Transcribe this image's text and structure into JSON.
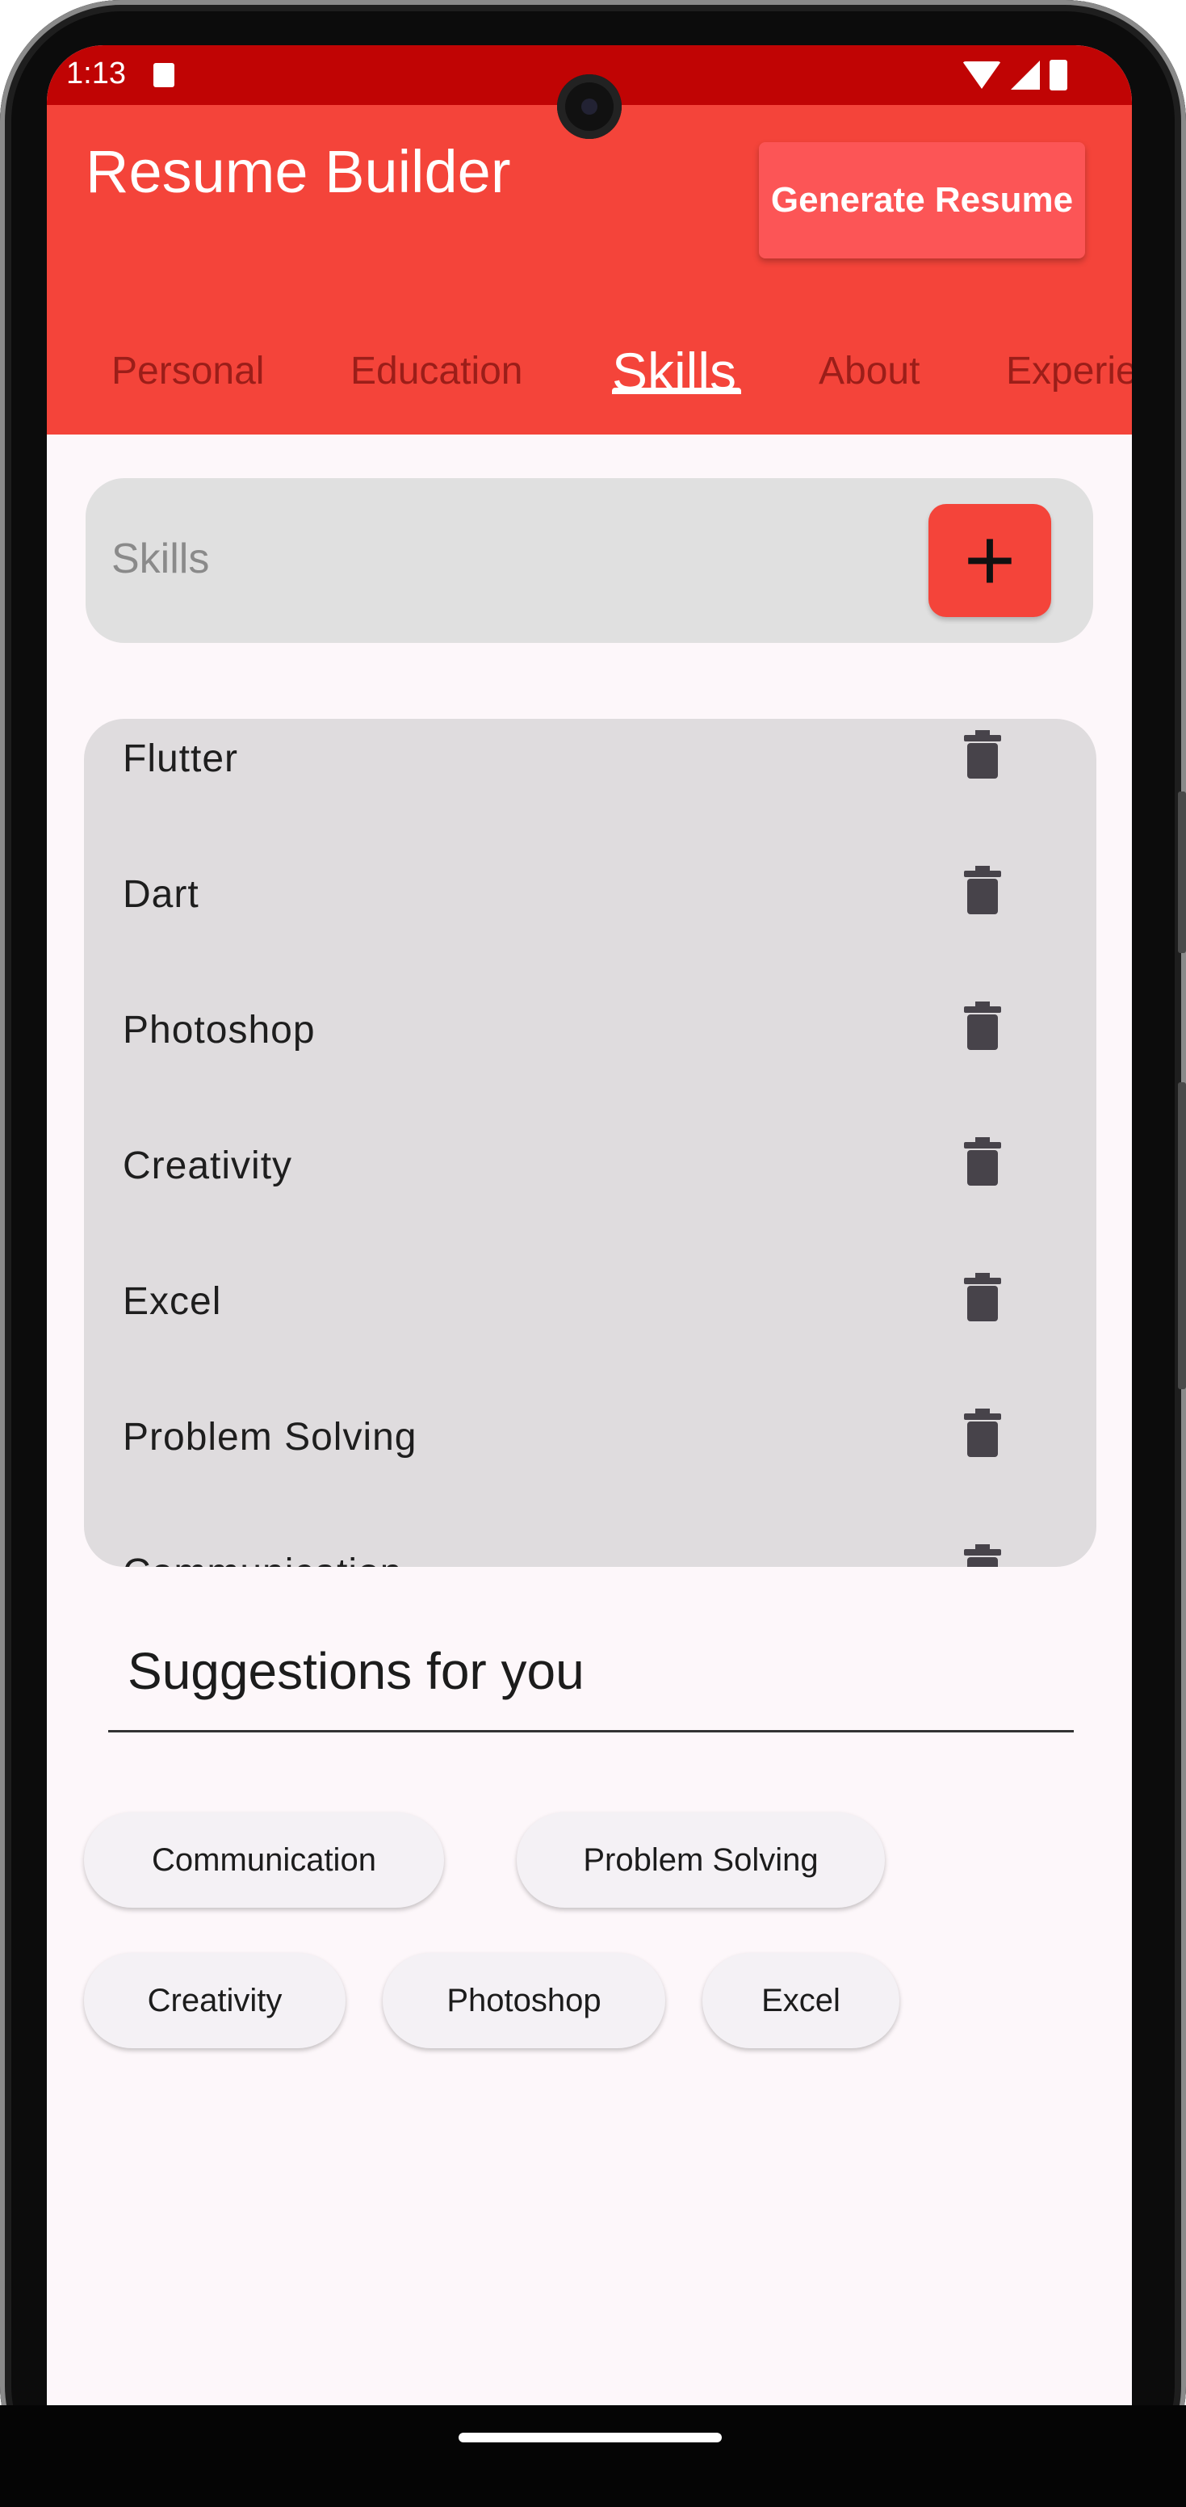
{
  "status_bar": {
    "time": "1:13"
  },
  "app_bar": {
    "title": "Resume Builder",
    "generate_label": "Generate Resume",
    "tabs": [
      {
        "label": "Personal"
      },
      {
        "label": "Education"
      },
      {
        "label": "Skills"
      },
      {
        "label": "About"
      },
      {
        "label": "Experie"
      }
    ],
    "active_tab": "Skills"
  },
  "skill_input": {
    "placeholder": "Skills",
    "add_icon": "plus-icon"
  },
  "skills": [
    {
      "name": "Flutter"
    },
    {
      "name": "Dart"
    },
    {
      "name": "Photoshop"
    },
    {
      "name": "Creativity"
    },
    {
      "name": "Excel"
    },
    {
      "name": "Problem Solving"
    },
    {
      "name": "Communication"
    }
  ],
  "suggestions": {
    "title": "Suggestions for you",
    "chips": [
      {
        "label": "Communication"
      },
      {
        "label": "Problem Solving"
      },
      {
        "label": "Creativity"
      },
      {
        "label": "Photoshop"
      },
      {
        "label": "Excel"
      }
    ]
  },
  "colors": {
    "accent": "#f4443a",
    "status_bar": "#c00404",
    "generate_button": "#fc5556",
    "background": "#fdf7fa"
  }
}
